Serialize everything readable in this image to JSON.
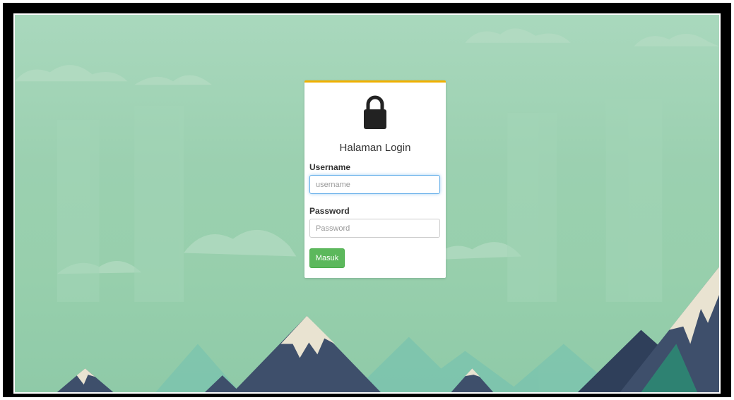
{
  "login": {
    "title": "Halaman Login",
    "username_label": "Username",
    "username_placeholder": "username",
    "password_label": "Password",
    "password_placeholder": "Password",
    "submit_label": "Masuk"
  },
  "icons": {
    "lock": "lock-icon"
  },
  "colors": {
    "card_top_border": "#f0b000",
    "button": "#5cb85c",
    "background": "#9bd0b0",
    "focus": "#66afe9"
  }
}
